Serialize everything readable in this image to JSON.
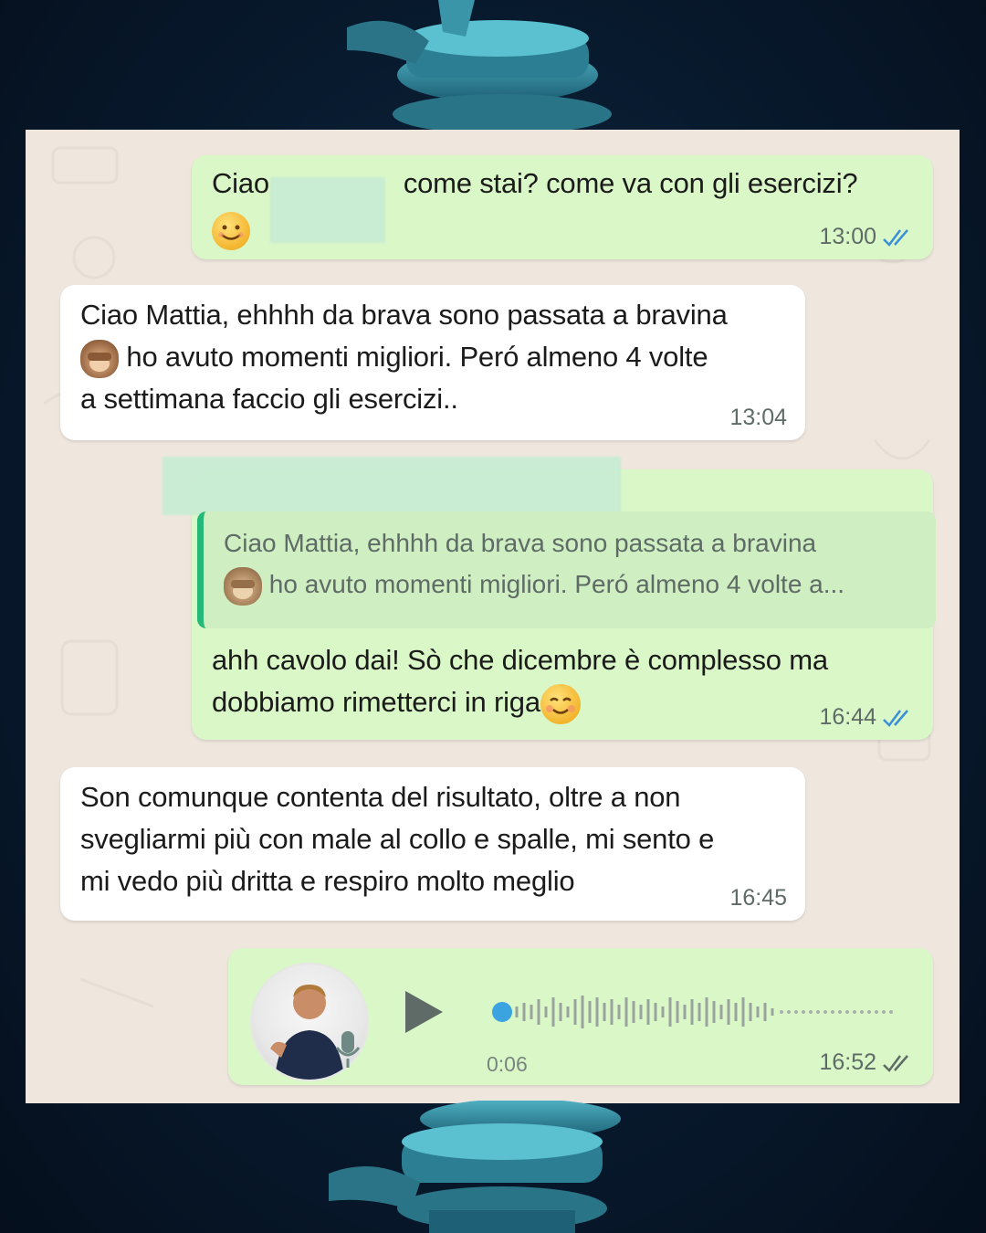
{
  "messages": [
    {
      "direction": "outgoing",
      "text_start": "Ciao",
      "text_end": "come stai?  come va con gli esercizi?",
      "time": "13:00",
      "status": "read"
    },
    {
      "direction": "incoming",
      "line1": "Ciao Mattia, ehhhh da brava sono passata a bravina",
      "line2": "ho avuto momenti migliori. Peró almeno 4 volte",
      "line3": "a settimana faccio gli esercizi..",
      "time": "13:04"
    },
    {
      "direction": "outgoing",
      "quoted_line1": "Ciao Mattia, ehhhh da brava sono passata a bravina",
      "quoted_line2": "ho avuto momenti migliori. Peró almeno 4 volte a...",
      "line1": "ahh cavolo dai! Sò che dicembre è complesso ma",
      "line2": "dobbiamo rimetterci in riga",
      "time": "16:44",
      "status": "read"
    },
    {
      "direction": "incoming",
      "line1": "Son comunque contenta del risultato, oltre a non",
      "line2": "svegliarmi più con male al collo e spalle, mi sento e",
      "line3": "mi vedo più dritta e respiro molto meglio",
      "time": "16:45"
    },
    {
      "direction": "outgoing",
      "type": "voice",
      "duration": "0:06",
      "time": "16:52",
      "status": "delivered"
    }
  ],
  "colors": {
    "outgoing_bubble": "#d9f7c7",
    "incoming_bubble": "#ffffff",
    "chat_background": "#efe7de",
    "read_ticks": "#3a8fd8",
    "delivered_ticks": "#5f6b66",
    "quote_bar": "#26b878"
  },
  "icons": [
    "smiling-face-emoji",
    "see-no-evil-monkey-emoji",
    "blushing-face-emoji",
    "double-check-icon",
    "play-icon",
    "microphone-icon"
  ]
}
